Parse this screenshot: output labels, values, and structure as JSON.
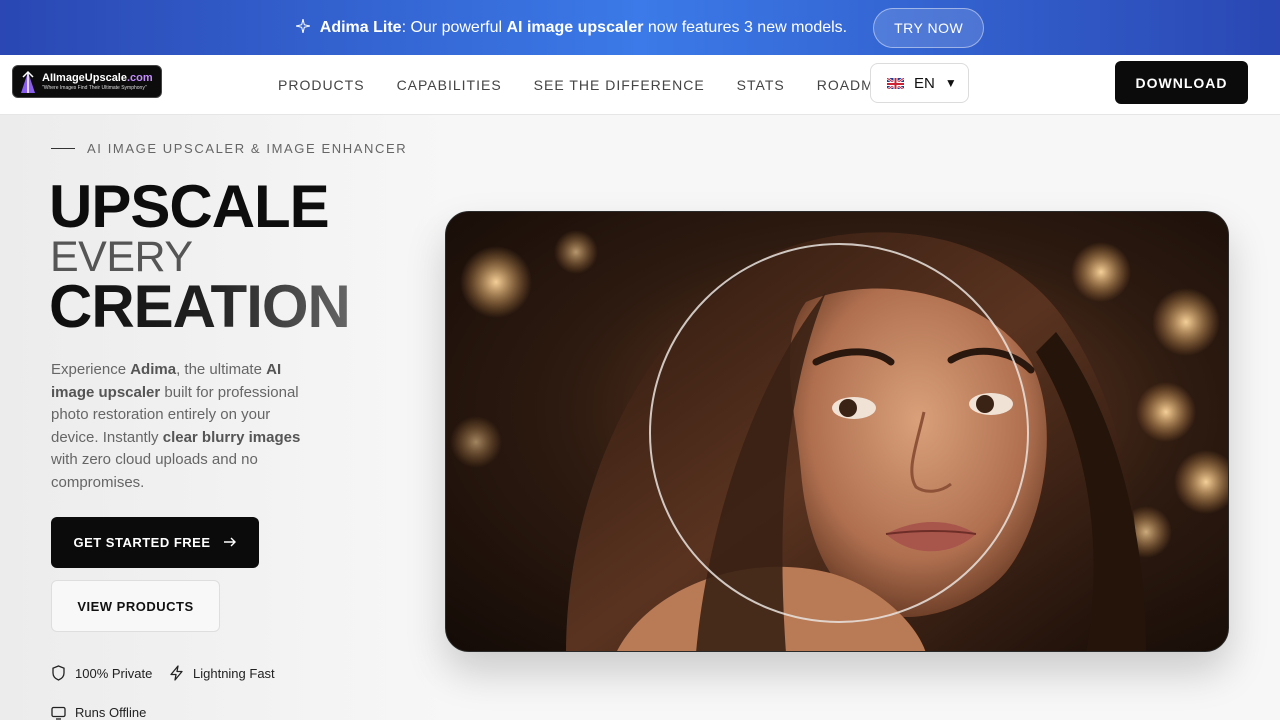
{
  "announcement": {
    "brand": "Adima Lite",
    "text_prefix": ": Our powerful ",
    "highlight": "AI image upscaler",
    "text_suffix": " now features 3 new models.",
    "cta": "TRY NOW"
  },
  "nav": {
    "logo_brand_main": "AIImageUpscale",
    "logo_brand_tld": ".com",
    "logo_tagline": "\"Where Images Find Their Ultimate Symphony\"",
    "items": [
      "PRODUCTS",
      "CAPABILITIES",
      "SEE THE DIFFERENCE",
      "STATS",
      "ROADMAP"
    ],
    "language": "EN",
    "download": "DOWNLOAD"
  },
  "hero": {
    "eyebrow": "AI IMAGE UPSCALER & IMAGE ENHANCER",
    "line1": "UPSCALE",
    "line2": "EVERY",
    "line3": "CREATION",
    "desc": {
      "t1": "Experience ",
      "b1": "Adima",
      "t2": ", the ultimate ",
      "b2": "AI image upscaler",
      "t3": " built for professional photo restoration entirely on your device. Instantly ",
      "b3": "clear blurry images",
      "t4": " with zero cloud uploads and no compromises."
    },
    "cta_primary": "GET STARTED FREE",
    "cta_secondary": "VIEW PRODUCTS",
    "features": [
      "100% Private",
      "Lightning Fast",
      "Runs Offline"
    ]
  },
  "colors": {
    "announce_bg": "#3b7ae8",
    "primary_button": "#0b0b0b"
  },
  "icons": {
    "announce": "sparkle-icon",
    "cta_arrow": "arrow-right-icon",
    "features": [
      "shield-icon",
      "lightning-icon",
      "monitor-icon"
    ],
    "lang_flag": "uk-flag-icon",
    "lang_caret": "caret-down-icon"
  }
}
